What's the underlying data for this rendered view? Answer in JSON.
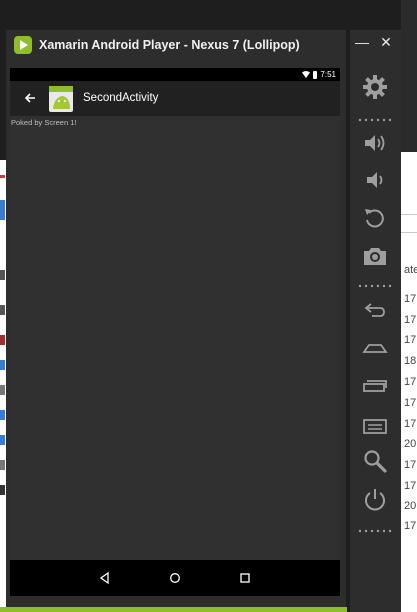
{
  "window": {
    "title": "Xamarin Android Player - Nexus 7 (Lollipop)",
    "minimize_label": "—",
    "close_label": "✕"
  },
  "device": {
    "status_time": "7:51",
    "action_bar": {
      "title": "SecondActivity"
    },
    "content_text": "Poked by Screen 1!"
  },
  "background_window": {
    "numbers": [
      "ate",
      "17",
      "17",
      "17",
      "18",
      "17",
      "17",
      "17",
      "20",
      "17",
      "17",
      "20",
      "17"
    ]
  },
  "colors": {
    "accent": "#8fbd2c",
    "toolbar_bg": "#2d2d2d",
    "screen_bg": "#303030",
    "action_bar_bg": "#212121",
    "icon_color": "#9e9e9e"
  }
}
